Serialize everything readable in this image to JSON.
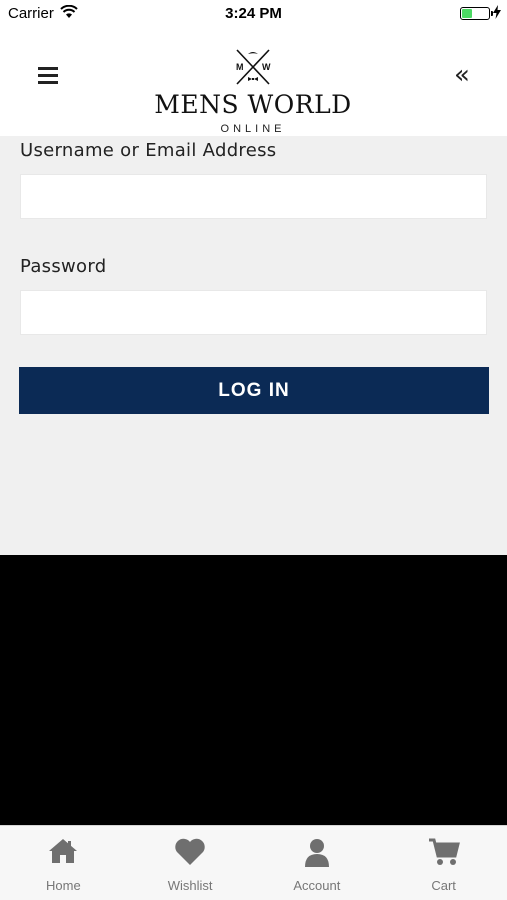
{
  "status_bar": {
    "carrier": "Carrier",
    "time": "3:24 PM"
  },
  "header": {
    "logo_mark_letters": [
      "M",
      "W"
    ],
    "logo_title": "MENS WORLD",
    "logo_subtitle": "ONLINE"
  },
  "login_form": {
    "username_label": "Username or Email Address",
    "username_value": "",
    "password_label": "Password",
    "password_value": "",
    "submit_label": "LOG IN",
    "submit_color": "#0b2a55"
  },
  "tab_bar": {
    "tabs": [
      {
        "label": "Home",
        "icon": "home-icon"
      },
      {
        "label": "Wishlist",
        "icon": "heart-icon"
      },
      {
        "label": "Account",
        "icon": "user-icon"
      },
      {
        "label": "Cart",
        "icon": "cart-icon"
      }
    ]
  }
}
